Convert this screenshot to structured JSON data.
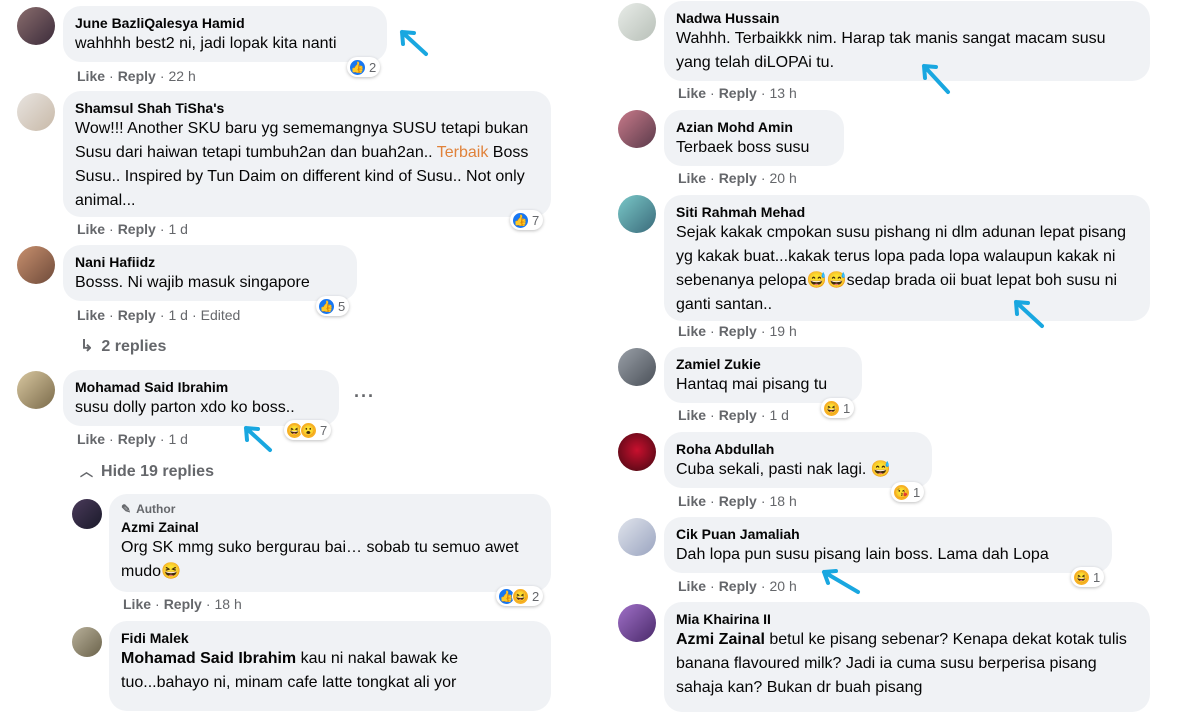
{
  "meta_labels": {
    "like": "Like",
    "reply": "Reply"
  },
  "left": [
    {
      "name": "June BazliQalesya Hamid",
      "text": "wahhhh best2 ni, jadi lopak kita nanti",
      "time": "22 h",
      "count": "2"
    },
    {
      "name": "Shamsul Shah TiSha's",
      "text_a": "Wow!!! Another SKU baru yg sememangnya SUSU tetapi bukan Susu dari haiwan tetapi tumbuh2an dan buah2an.. ",
      "text_highlight": "Terbaik",
      "text_b": " Boss Susu.. Inspired by Tun Daim on different kind of Susu.. Not only animal...",
      "time": "1 d",
      "count": "7"
    },
    {
      "name": "Nani Hafiidz",
      "text": "Bosss. Ni wajib masuk singapore",
      "time": "1 d",
      "edited": "Edited",
      "count": "5"
    },
    {
      "name": "Mohamad Said Ibrahim",
      "text": "susu dolly parton xdo ko boss..",
      "time": "1 d",
      "count": "7"
    }
  ],
  "left_replies_toggle": {
    "replies": "2 replies",
    "hide": "Hide 19 replies"
  },
  "nested": [
    {
      "badge": "Author",
      "name": "Azmi Zainal",
      "text": "Org SK mmg suko bergurau bai… sobab tu semuo awet mudo",
      "emoji": "😆",
      "time": "18 h",
      "count": "2"
    },
    {
      "name": "Fidi Malek",
      "tag": "Mohamad Said Ibrahim",
      "text": " kau ni nakal bawak ke tuo...bahayo ni, minam cafe latte tongkat ali yor"
    }
  ],
  "right": [
    {
      "name": "Nadwa Hussain",
      "text": "Wahhh. Terbaikkk nim. Harap tak manis sangat macam susu yang telah diLOPAi tu.",
      "time": "13 h"
    },
    {
      "name": "Azian Mohd Amin",
      "text": "Terbaek boss susu",
      "time": "20 h"
    },
    {
      "name": "Siti Rahmah Mehad",
      "text": "Sejak kakak cmpokan susu pishang ni dlm adunan lepat pisang yg kakak buat...kakak terus lopa pada lopa walaupun kakak ni sebenanya pelopa",
      "emoji": "😅😅",
      "text_b": "sedap brada oii buat lepat boh susu ni ganti santan..",
      "time": "19 h"
    },
    {
      "name": "Zamiel Zukie",
      "text": "Hantaq mai pisang tu",
      "time": "1 d",
      "count": "1"
    },
    {
      "name": "Roha Abdullah",
      "text": "Cuba sekali, pasti nak lagi.",
      "emoji": "😅",
      "time": "18 h",
      "count": "1"
    },
    {
      "name": "Cik Puan Jamaliah",
      "text": "Dah lopa pun susu pisang lain boss. Lama dah Lopa",
      "time": "20 h",
      "count": "1"
    },
    {
      "name": "Mia Khairina II",
      "tag": "Azmi Zainal",
      "text": " betul ke pisang sebenar? Kenapa dekat kotak tulis banana flavoured milk? Jadi ia cuma susu berperisa pisang sahaja kan? Bukan dr buah pisang"
    }
  ],
  "colors": {
    "bubble": "#f0f2f5",
    "meta": "#65676b",
    "like_blue": "#1877f2",
    "arrow": "#19a7e0",
    "highlight": "#e0823a"
  }
}
